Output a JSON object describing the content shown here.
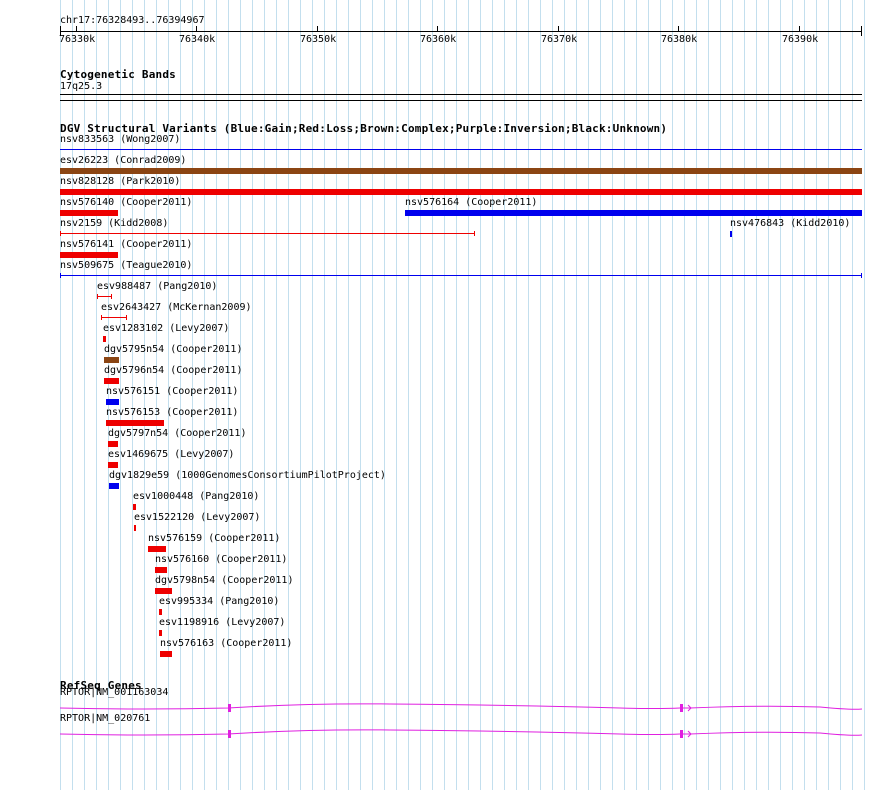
{
  "ruler": {
    "locus": "chr17:76328493..76394967",
    "ticks": [
      "76330k",
      "76340k",
      "76350k",
      "76360k",
      "76370k",
      "76380k",
      "76390k"
    ]
  },
  "colors": {
    "gain": "#0000ee",
    "loss": "#ee0000",
    "complex": "#8b4513",
    "gene": "#e020e0",
    "grid": "#c3dfee"
  },
  "tracks": {
    "cytobands": {
      "title": "Cytogenetic Bands",
      "band": "17q25.3"
    },
    "dgv": {
      "title": "DGV Structural Variants (Blue:Gain;Red:Loss;Brown:Complex;Purple:Inversion;Black:Unknown)",
      "features": [
        {
          "label": "nsv833563 (Wong2007)",
          "type": "unknown"
        },
        {
          "label": "esv26223 (Conrad2009)",
          "type": "complex"
        },
        {
          "label": "nsv828128 (Park2010)",
          "type": "loss"
        },
        {
          "label": "nsv576140 (Cooper2011)",
          "type": "loss"
        },
        {
          "label": "nsv576164 (Cooper2011)",
          "type": "gain"
        },
        {
          "label": "nsv2159 (Kidd2008)",
          "type": "loss"
        },
        {
          "label": "nsv476843 (Kidd2010)",
          "type": "gain"
        },
        {
          "label": "nsv576141 (Cooper2011)",
          "type": "loss"
        },
        {
          "label": "nsv509675 (Teague2010)",
          "type": "gain"
        },
        {
          "label": "esv988487 (Pang2010)",
          "type": "loss"
        },
        {
          "label": "esv2643427 (McKernan2009)",
          "type": "loss"
        },
        {
          "label": "esv1283102 (Levy2007)",
          "type": "loss"
        },
        {
          "label": "dgv5795n54 (Cooper2011)",
          "type": "complex"
        },
        {
          "label": "dgv5796n54 (Cooper2011)",
          "type": "loss"
        },
        {
          "label": "nsv576151 (Cooper2011)",
          "type": "gain"
        },
        {
          "label": "nsv576153 (Cooper2011)",
          "type": "loss"
        },
        {
          "label": "dgv5797n54 (Cooper2011)",
          "type": "loss"
        },
        {
          "label": "esv1469675 (Levy2007)",
          "type": "loss"
        },
        {
          "label": "dgv1829e59 (1000GenomesConsortiumPilotProject)",
          "type": "gain"
        },
        {
          "label": "esv1000448 (Pang2010)",
          "type": "loss"
        },
        {
          "label": "esv1522120 (Levy2007)",
          "type": "loss"
        },
        {
          "label": "nsv576159 (Cooper2011)",
          "type": "loss"
        },
        {
          "label": "nsv576160 (Cooper2011)",
          "type": "loss"
        },
        {
          "label": "dgv5798n54 (Cooper2011)",
          "type": "loss"
        },
        {
          "label": "esv995334 (Pang2010)",
          "type": "loss"
        },
        {
          "label": "esv1198916 (Levy2007)",
          "type": "loss"
        },
        {
          "label": "nsv576163 (Cooper2011)",
          "type": "loss"
        }
      ]
    },
    "refseq": {
      "title": "RefSeq Genes",
      "genes": [
        {
          "label": "RPTOR|NM_001163034"
        },
        {
          "label": "RPTOR|NM_020761"
        }
      ]
    }
  }
}
